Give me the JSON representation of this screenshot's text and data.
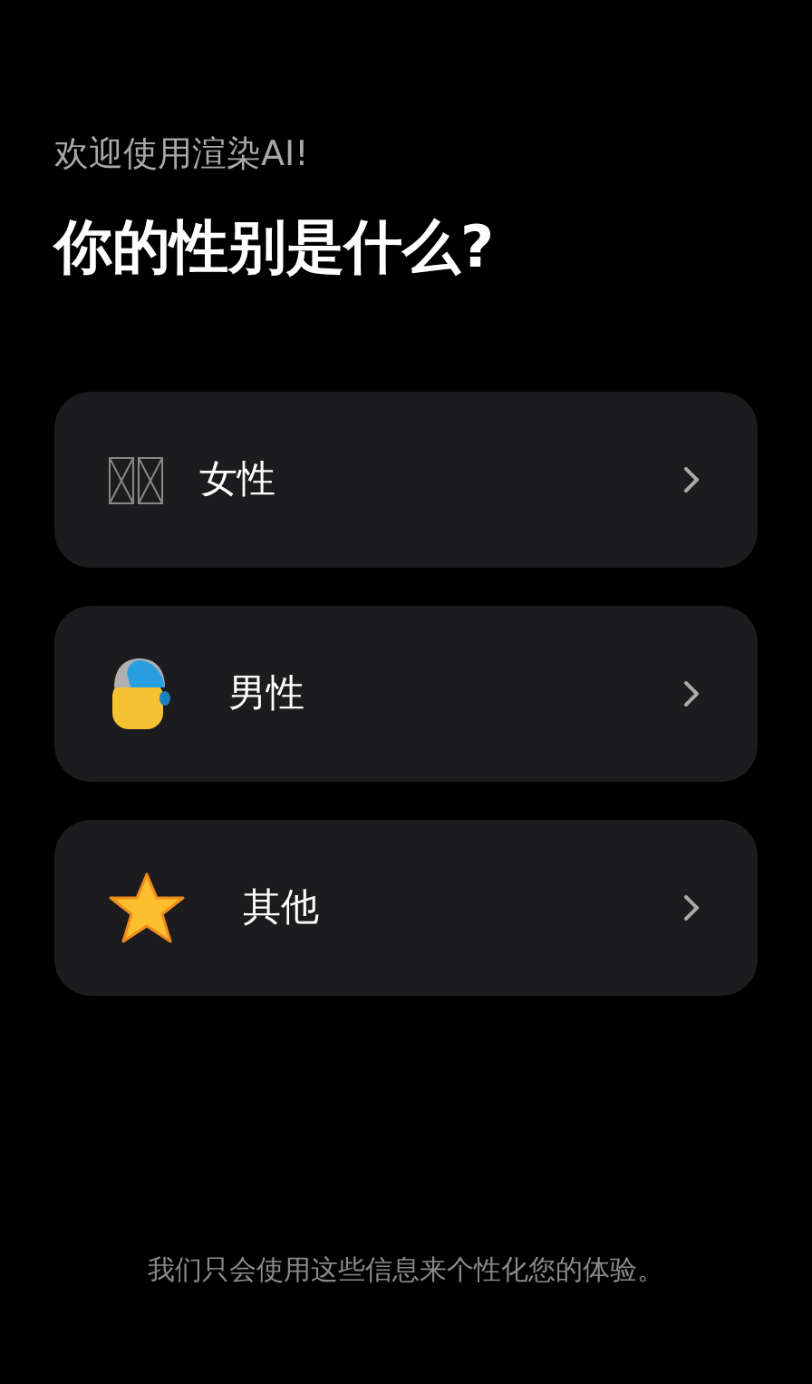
{
  "subtitle": "欢迎使用渲染AI!",
  "title": "你的性别是什么?",
  "options": [
    {
      "kind": "tofu",
      "label": "女性"
    },
    {
      "kind": "cap",
      "label": "男性"
    },
    {
      "kind": "star",
      "label": "其他"
    }
  ],
  "footer": "我们只会使用这些信息来个性化您的体验。"
}
